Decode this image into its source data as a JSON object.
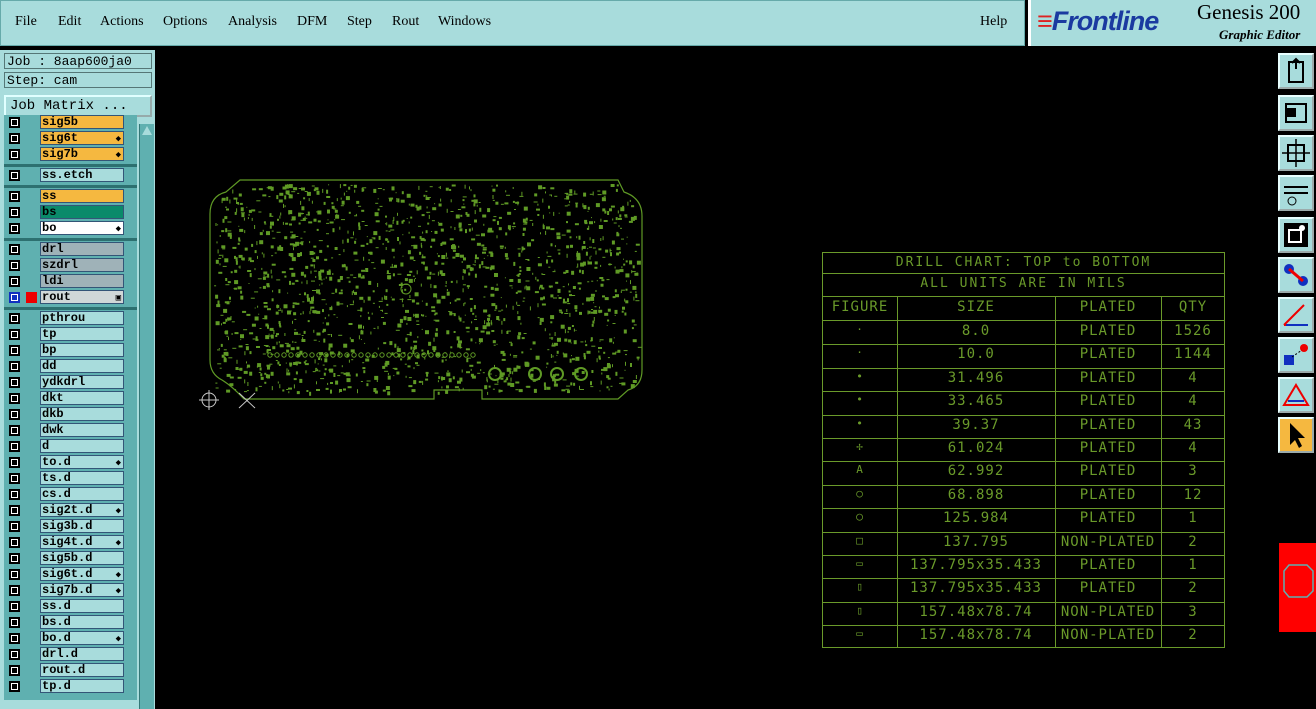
{
  "menu": [
    "File",
    "Edit",
    "Actions",
    "Options",
    "Analysis",
    "DFM",
    "Step",
    "Rout",
    "Windows"
  ],
  "help": "Help",
  "brand": {
    "logo": "Frontline",
    "product": "Genesis 200",
    "subtitle": "Graphic Editor"
  },
  "job": {
    "job_label": "Job : 8aap600ja0",
    "step_label": "Step: cam",
    "matrix_button": "Job Matrix ..."
  },
  "layers": [
    {
      "name": "sig5b",
      "color": "#f5b840",
      "mark": ""
    },
    {
      "name": "sig6t",
      "color": "#f5b840",
      "mark": "◆"
    },
    {
      "name": "sig7b",
      "color": "#f5b840",
      "mark": "◆"
    },
    {
      "name": "ss.etch",
      "color": "#a8dcdc",
      "mark": ""
    },
    {
      "name": "ss",
      "color": "#f5b840",
      "mark": ""
    },
    {
      "name": "bs",
      "color": "#0a8a6a",
      "mark": ""
    },
    {
      "name": "bo",
      "color": "#ffffff",
      "mark": "◆"
    },
    {
      "name": "drl",
      "color": "#9fb2b8",
      "mark": ""
    },
    {
      "name": "szdrl",
      "color": "#9fb2b8",
      "mark": ""
    },
    {
      "name": "ldi",
      "color": "#9fb2b8",
      "mark": ""
    },
    {
      "name": "rout",
      "color": "#d0d8d8",
      "mark": "▣"
    },
    {
      "name": "pthrou",
      "color": "#a8dcdc",
      "mark": ""
    },
    {
      "name": "tp",
      "color": "#a8dcdc",
      "mark": ""
    },
    {
      "name": "bp",
      "color": "#a8dcdc",
      "mark": ""
    },
    {
      "name": "dd",
      "color": "#a8dcdc",
      "mark": ""
    },
    {
      "name": "ydkdrl",
      "color": "#a8dcdc",
      "mark": ""
    },
    {
      "name": "dkt",
      "color": "#a8dcdc",
      "mark": ""
    },
    {
      "name": "dkb",
      "color": "#a8dcdc",
      "mark": ""
    },
    {
      "name": "dwk",
      "color": "#a8dcdc",
      "mark": ""
    },
    {
      "name": "d",
      "color": "#a8dcdc",
      "mark": ""
    },
    {
      "name": "to.d",
      "color": "#a8dcdc",
      "mark": "◆"
    },
    {
      "name": "ts.d",
      "color": "#a8dcdc",
      "mark": ""
    },
    {
      "name": "cs.d",
      "color": "#a8dcdc",
      "mark": ""
    },
    {
      "name": "sig2t.d",
      "color": "#a8dcdc",
      "mark": "◆"
    },
    {
      "name": "sig3b.d",
      "color": "#a8dcdc",
      "mark": ""
    },
    {
      "name": "sig4t.d",
      "color": "#a8dcdc",
      "mark": "◆"
    },
    {
      "name": "sig5b.d",
      "color": "#a8dcdc",
      "mark": ""
    },
    {
      "name": "sig6t.d",
      "color": "#a8dcdc",
      "mark": "◆"
    },
    {
      "name": "sig7b.d",
      "color": "#a8dcdc",
      "mark": "◆"
    },
    {
      "name": "ss.d",
      "color": "#a8dcdc",
      "mark": ""
    },
    {
      "name": "bs.d",
      "color": "#a8dcdc",
      "mark": ""
    },
    {
      "name": "bo.d",
      "color": "#a8dcdc",
      "mark": "◆"
    },
    {
      "name": "drl.d",
      "color": "#a8dcdc",
      "mark": ""
    },
    {
      "name": "rout.d",
      "color": "#a8dcdc",
      "mark": ""
    },
    {
      "name": "tp.d",
      "color": "#a8dcdc",
      "mark": ""
    }
  ],
  "drill_chart": {
    "title1": "DRILL CHART: TOP to BOTTOM",
    "title2": "ALL UNITS ARE IN MILS",
    "headers": [
      "FIGURE",
      "SIZE",
      "PLATED",
      "QTY"
    ],
    "rows": [
      {
        "fig": "·",
        "size": "8.0",
        "plated": "PLATED",
        "qty": "1526"
      },
      {
        "fig": "·",
        "size": "10.0",
        "plated": "PLATED",
        "qty": "1144"
      },
      {
        "fig": "•",
        "size": "31.496",
        "plated": "PLATED",
        "qty": "4"
      },
      {
        "fig": "•",
        "size": "33.465",
        "plated": "PLATED",
        "qty": "4"
      },
      {
        "fig": "•",
        "size": "39.37",
        "plated": "PLATED",
        "qty": "43"
      },
      {
        "fig": "✢",
        "size": "61.024",
        "plated": "PLATED",
        "qty": "4"
      },
      {
        "fig": "A",
        "size": "62.992",
        "plated": "PLATED",
        "qty": "3"
      },
      {
        "fig": "○",
        "size": "68.898",
        "plated": "PLATED",
        "qty": "12"
      },
      {
        "fig": "◯",
        "size": "125.984",
        "plated": "PLATED",
        "qty": "1"
      },
      {
        "fig": "□",
        "size": "137.795",
        "plated": "NON-PLATED",
        "qty": "2"
      },
      {
        "fig": "▭",
        "size": "137.795x35.433",
        "plated": "PLATED",
        "qty": "1"
      },
      {
        "fig": "▯",
        "size": "137.795x35.433",
        "plated": "PLATED",
        "qty": "2"
      },
      {
        "fig": "▯",
        "size": "157.48x78.74",
        "plated": "NON-PLATED",
        "qty": "3"
      },
      {
        "fig": "▭",
        "size": "157.48x78.74",
        "plated": "NON-PLATED",
        "qty": "2"
      }
    ]
  },
  "colors": {
    "ui": "#a8dcdc",
    "pcb": "#5f9a25",
    "chart": "#6a9a2a",
    "background": "#000000"
  },
  "toolbar_icons": [
    "zoom-home-icon",
    "zoom-back-icon",
    "zoom-fit-icon",
    "measure-icon",
    "snap-icon",
    "connect-icon",
    "angle-icon",
    "select-feature-icon",
    "triangle-icon",
    "pointer-icon"
  ]
}
